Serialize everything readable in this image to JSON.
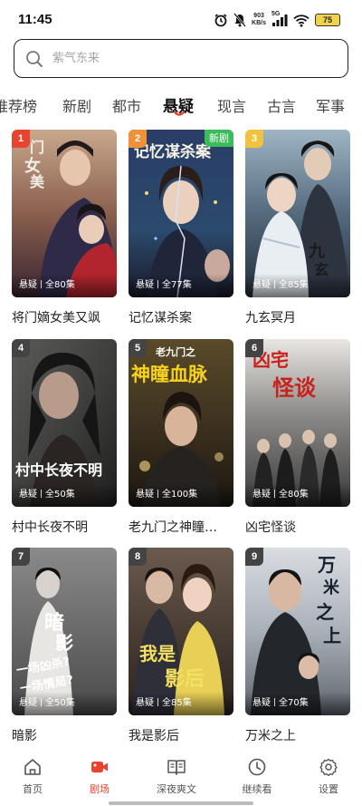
{
  "status": {
    "time": "11:45",
    "net_speed_value": "903",
    "net_speed_unit": "KB/s",
    "signal_label": "5G",
    "battery": "75"
  },
  "search": {
    "placeholder": "紫气东来"
  },
  "tabs": [
    "推荐榜",
    "新剧",
    "都市",
    "悬疑",
    "现言",
    "古言",
    "军事"
  ],
  "active_tab": "悬疑",
  "colors": {
    "accent": "#e8432f",
    "new_badge": "#3bbc5a",
    "rank_1": "#e8432f",
    "rank_2": "#f0913a",
    "rank_3": "#f2c23c",
    "rank_other": "#444444"
  },
  "dramas": [
    {
      "rank": "1",
      "title": "将门嫡女美又飒",
      "genre": "悬疑",
      "episodes": "全80集",
      "is_new": false
    },
    {
      "rank": "2",
      "title": "记忆谋杀案",
      "genre": "悬疑",
      "episodes": "全77集",
      "is_new": true,
      "new_label": "新剧"
    },
    {
      "rank": "3",
      "title": "九玄冥月",
      "genre": "悬疑",
      "episodes": "全85集",
      "is_new": false
    },
    {
      "rank": "4",
      "title": "村中长夜不明",
      "genre": "悬疑",
      "episodes": "全50集",
      "is_new": false
    },
    {
      "rank": "5",
      "title": "老九门之神瞳…",
      "genre": "悬疑",
      "episodes": "全100集",
      "is_new": false
    },
    {
      "rank": "6",
      "title": "凶宅怪谈",
      "genre": "悬疑",
      "episodes": "全80集",
      "is_new": false
    },
    {
      "rank": "7",
      "title": "暗影",
      "genre": "悬疑",
      "episodes": "全50集",
      "is_new": false
    },
    {
      "rank": "8",
      "title": "我是影后",
      "genre": "悬疑",
      "episodes": "全85集",
      "is_new": false
    },
    {
      "rank": "9",
      "title": "万米之上",
      "genre": "悬疑",
      "episodes": "全70集",
      "is_new": false
    }
  ],
  "bottom_nav": [
    {
      "label": "首页",
      "icon": "home-icon"
    },
    {
      "label": "剧场",
      "icon": "video-camera-icon",
      "active": true
    },
    {
      "label": "深夜爽文",
      "icon": "open-book-icon"
    },
    {
      "label": "继续看",
      "icon": "clock-icon"
    },
    {
      "label": "设置",
      "icon": "gear-icon"
    }
  ]
}
